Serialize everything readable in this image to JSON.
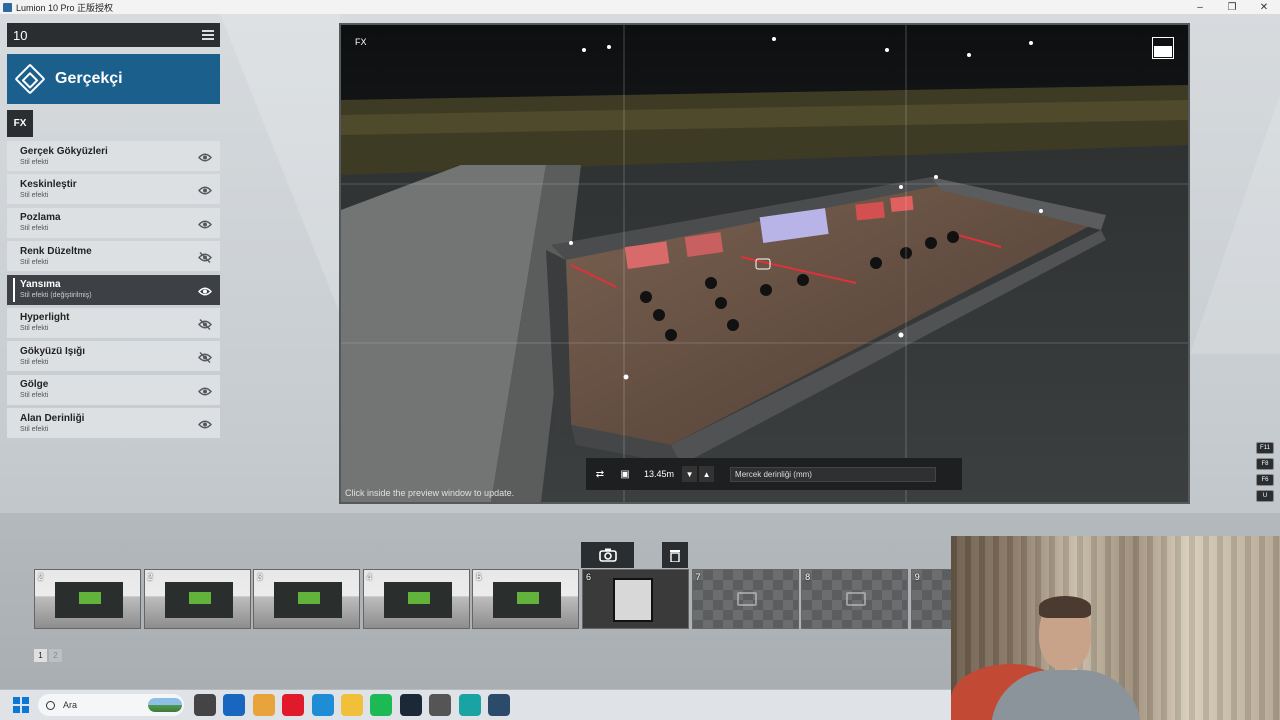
{
  "window": {
    "title": "Lumion 10 Pro 正版授权"
  },
  "panel": {
    "page_number": "10",
    "style_name": "Gerçekçi",
    "fx_tag": "FX",
    "effects": [
      {
        "name": "Gerçek Gökyüzleri",
        "sub": "Stil efekti",
        "visible": true,
        "active": false
      },
      {
        "name": "Keskinleştir",
        "sub": "Stil efekti",
        "visible": true,
        "active": false
      },
      {
        "name": "Pozlama",
        "sub": "Stil efekti",
        "visible": true,
        "active": false
      },
      {
        "name": "Renk Düzeltme",
        "sub": "Stil efekti",
        "visible": false,
        "active": false
      },
      {
        "name": "Yansıma",
        "sub": "Stil efekti (değiştirilmiş)",
        "visible": true,
        "active": true
      },
      {
        "name": "Hyperlight",
        "sub": "Stil efekti",
        "visible": false,
        "active": false
      },
      {
        "name": "Gökyüzü Işığı",
        "sub": "Stil efekti",
        "visible": false,
        "active": false
      },
      {
        "name": "Gölge",
        "sub": "Stil efekti",
        "visible": true,
        "active": false
      },
      {
        "name": "Alan Derinliği",
        "sub": "Stil efekti",
        "visible": true,
        "active": false
      }
    ]
  },
  "viewport": {
    "fx_label": "FX",
    "hint": "Click inside the preview window to update.",
    "camera_distance": "13.45m",
    "lens_placeholder": "Mercek derinliği (mm)"
  },
  "function_keys": [
    "F11",
    "F8",
    "F6",
    "U"
  ],
  "thumbnails": [
    {
      "num": "2",
      "kind": "filled"
    },
    {
      "num": "2",
      "kind": "filled"
    },
    {
      "num": "3",
      "kind": "filled"
    },
    {
      "num": "4",
      "kind": "filled"
    },
    {
      "num": "5",
      "kind": "filled"
    },
    {
      "num": "6",
      "kind": "dark"
    },
    {
      "num": "7",
      "kind": "empty"
    },
    {
      "num": "8",
      "kind": "empty"
    },
    {
      "num": "9",
      "kind": "empty"
    }
  ],
  "pager": {
    "current": "1",
    "other": "2"
  },
  "taskbar": {
    "search_label": "Ara",
    "apps": [
      {
        "icon": "task-view-icon",
        "color": "#444444"
      },
      {
        "icon": "outlook-icon",
        "color": "#1866c0"
      },
      {
        "icon": "chrome-icon",
        "color": "#e8a33a"
      },
      {
        "icon": "opera-icon",
        "color": "#e01a2b"
      },
      {
        "icon": "edge-icon",
        "color": "#1f8dd6"
      },
      {
        "icon": "folder-icon",
        "color": "#f0c03a"
      },
      {
        "icon": "spotify-icon",
        "color": "#1db954"
      },
      {
        "icon": "steam-icon",
        "color": "#1b2838"
      },
      {
        "icon": "recorder-icon",
        "color": "#555555"
      },
      {
        "icon": "app-3-icon",
        "color": "#1aa3a3"
      },
      {
        "icon": "lumion-icon",
        "color": "#2c4b6a"
      }
    ]
  }
}
